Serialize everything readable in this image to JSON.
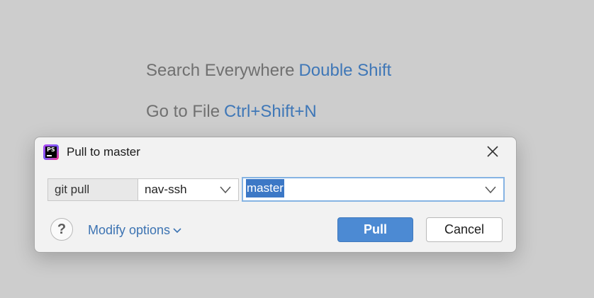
{
  "background_hints": [
    {
      "label": "Search Everywhere",
      "shortcut": "Double Shift"
    },
    {
      "label": "Go to File",
      "shortcut": "Ctrl+Shift+N"
    }
  ],
  "dialog": {
    "title": "Pull to master",
    "app_icon": "phpstorm-icon",
    "close_icon": "close-icon",
    "command_label": "git pull",
    "remote_value": "nav-ssh",
    "branch_value": "master",
    "help_label": "?",
    "modify_options_label": "Modify options",
    "pull_label": "Pull",
    "cancel_label": "Cancel"
  },
  "colors": {
    "accent": "#4c8ad3",
    "link": "#3c73b2",
    "shortcut": "#3f77b7",
    "focus_border": "#86b4e3",
    "selection": "#3c78c6"
  }
}
